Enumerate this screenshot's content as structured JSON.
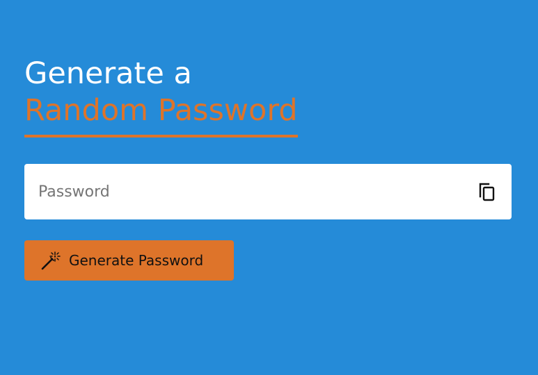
{
  "heading": {
    "line1": "Generate a",
    "line2": "Random Password"
  },
  "password_field": {
    "value": "",
    "placeholder": "Password"
  },
  "generate_button": {
    "label": "Generate Password"
  },
  "icons": {
    "copy": "copy-icon",
    "wand": "magic-wand-icon"
  },
  "colors": {
    "background": "#258bd8",
    "accent": "#de742a",
    "title": "#ffffff"
  }
}
